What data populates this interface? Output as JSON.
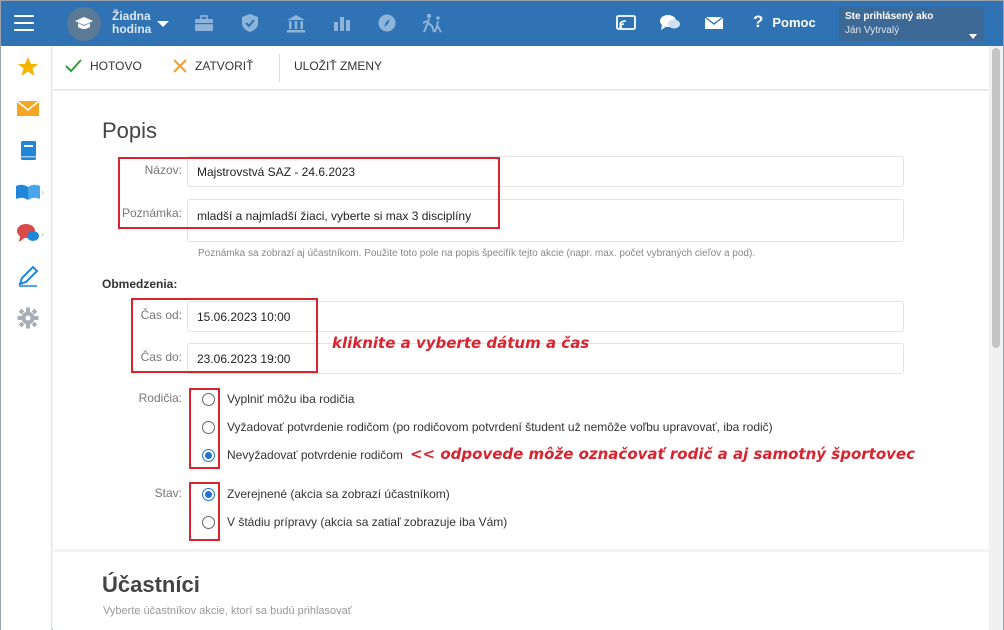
{
  "topbar": {
    "school_line1": "Žiadna",
    "school_line2": "hodina",
    "help_label": "Pomoc",
    "user_label": "Ste prihlásený ako",
    "user_name": "Ján Vytrvalý"
  },
  "toolbar": {
    "done_label": "HOTOVO",
    "close_label": "ZATVORIŤ",
    "save_label": "ULOŽIŤ ZMENY"
  },
  "form": {
    "title": "Popis",
    "name_label": "Názov:",
    "name_value": "Majstrovstvá SAZ - 24.6.2023",
    "note_label": "Poznámka:",
    "note_value": "mladší a najmladší žiaci, vyberte si max 3 disciplíny",
    "note_help": "Poznámka sa zobrazí aj účastníkom. Použite toto pole na popis špecifík tejto akcie (napr. max. počet vybraných cieľov a pod).",
    "restrictions_title": "Obmedzenia:",
    "from_label": "Čas od:",
    "from_value": "15.06.2023 10:00",
    "to_label": "Čas do:",
    "to_value": "23.06.2023 19:00",
    "parents_label": "Rodičia:",
    "parent_options": [
      "Vyplniť môžu iba rodičia",
      "Vyžadovať potvrdenie rodičom (po rodičovom potvrdení študent už nemôže voľbu upravovať, iba rodič)",
      "Nevyžadovať potvrdenie rodičom"
    ],
    "parent_selected_index": 2,
    "state_label": "Stav:",
    "state_options": [
      "Zverejnené (akcia sa zobrazí účastníkom)",
      "V štádiu prípravy (akcia sa zatiaľ zobrazuje iba Vám)"
    ],
    "state_selected_index": 0
  },
  "participants": {
    "title": "Účastníci",
    "subtitle": "Vyberte účastníkov akcie, ktorí sa budú prihlasovať"
  },
  "annotations": {
    "time_hint": "kliknite a vyberte dátum a čas",
    "parent_hint": "<< odpovede môže označovať rodič a aj samotný športovec"
  },
  "colors": {
    "topbar": "#2f73b5",
    "accent_red": "#d9232f",
    "radio_checked": "#1f73d1",
    "done_green": "#2e9e3e",
    "close_orange": "#f0a030"
  },
  "icons": {
    "topbar": [
      "menu-icon",
      "graduation-cap-icon",
      "briefcase-icon",
      "shield-check-icon",
      "bank-icon",
      "bar-chart-icon",
      "compass-icon",
      "people-walking-icon",
      "cast-icon",
      "chat-bubbles-icon",
      "mail-icon",
      "help-icon"
    ],
    "sidebar": [
      "star-icon",
      "envelope-icon",
      "notebook-icon",
      "open-book-icon",
      "chat-icon",
      "pen-icon",
      "gear-icon"
    ]
  }
}
